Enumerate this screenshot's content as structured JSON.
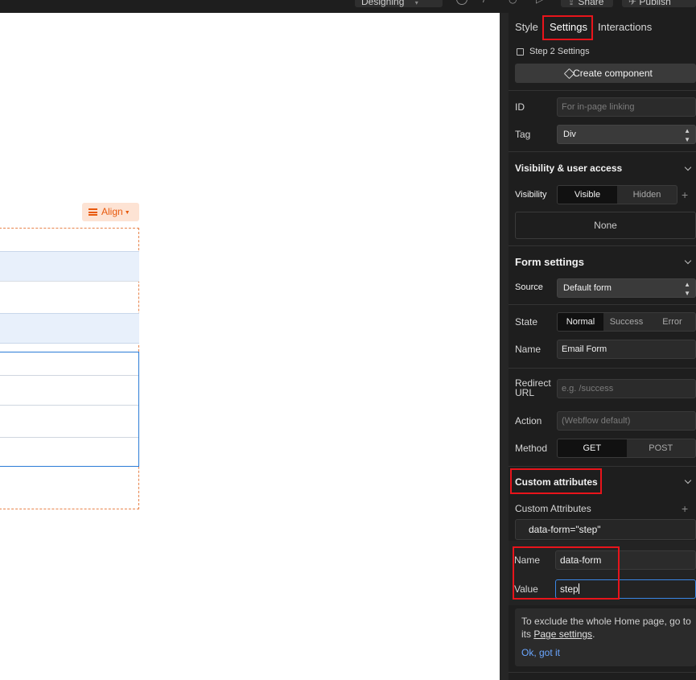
{
  "topbar": {
    "mode_label": "Designing",
    "share_label": "Share",
    "publish_label": "Publish"
  },
  "canvas": {
    "align_label": "Align"
  },
  "panel": {
    "tabs": {
      "style": "Style",
      "settings": "Settings",
      "interactions": "Interactions"
    },
    "element_title": "Step 2 Settings",
    "create_component": "Create component",
    "id": {
      "label": "ID",
      "placeholder": "For in-page linking"
    },
    "tag": {
      "label": "Tag",
      "value": "Div"
    },
    "visibility_section": {
      "title": "Visibility & user access",
      "visibility_label": "Visibility",
      "options": [
        "Visible",
        "Hidden"
      ],
      "selected": "Visible",
      "none_label": "None"
    },
    "form_section": {
      "title": "Form settings",
      "source_label": "Source",
      "source_value": "Default form",
      "state_label": "State",
      "state_options": [
        "Normal",
        "Success",
        "Error"
      ],
      "state_selected": "Normal",
      "name_label": "Name",
      "name_value": "Email Form",
      "redirect_label_1": "Redirect",
      "redirect_label_2": "URL",
      "redirect_placeholder": "e.g. /success",
      "action_label": "Action",
      "action_placeholder": "(Webflow default)",
      "method_label": "Method",
      "method_options": [
        "GET",
        "POST"
      ],
      "method_selected": "GET"
    },
    "custom_attributes_section": {
      "title": "Custom attributes",
      "list_label": "Custom Attributes",
      "attribute_display": "data-form=\"step\"",
      "name_label": "Name",
      "name_value": "data-form",
      "value_label": "Value",
      "value_value": "step"
    },
    "tip": {
      "text_1": "To exclude the whole Home page, go to its ",
      "link_text": "Page settings",
      "text_2": ".",
      "ok_label": "Ok, got it"
    }
  },
  "colors": {
    "panel_bg": "#1e1e1e",
    "highlight": "#e8141b",
    "accent_blue": "#3a87e6",
    "align_orange": "#e8590c"
  }
}
